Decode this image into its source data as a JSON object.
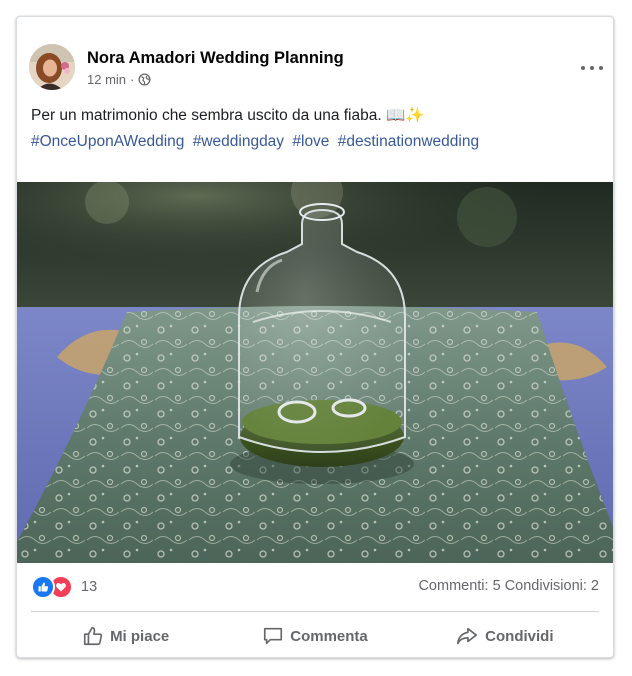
{
  "post": {
    "author": "Nora Amadori Wedding Planning",
    "time": "12 min",
    "separator": "·",
    "privacy_icon": "globe-icon",
    "more_icon": "more-options-icon",
    "text": "Per un matrimonio che sembra uscito da una fiaba. 📖✨",
    "hashtags": [
      "#OnceUponAWedding",
      "#weddingday",
      "#love",
      "#destinationwedding"
    ],
    "photo_icon": "wedding-rings-photo"
  },
  "stats": {
    "reaction_icons": [
      "like-icon",
      "love-icon"
    ],
    "reaction_count": "13",
    "comments": "Commenti: 5",
    "shares": "Condivisioni: 2"
  },
  "actions": {
    "like": "Mi piace",
    "comment": "Commenta",
    "share": "Condividi"
  },
  "colors": {
    "link": "#385898",
    "like_blue": "#1877f2",
    "love_red": "#f33e58",
    "secondary_text": "#65676b"
  }
}
